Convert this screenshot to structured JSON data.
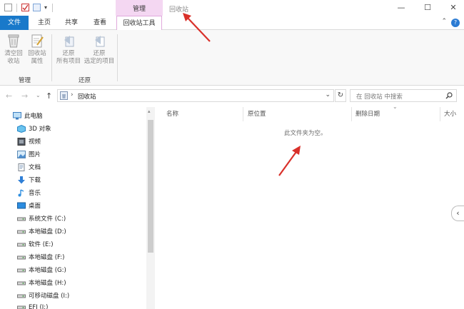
{
  "window": {
    "title": "回收站",
    "context_tab_group": "管理",
    "controls": {
      "minimize": "—",
      "maximize": "☐",
      "close": "✕"
    }
  },
  "tabs": [
    {
      "label": "文件"
    },
    {
      "label": "主页"
    },
    {
      "label": "共享"
    },
    {
      "label": "查看"
    },
    {
      "label": "回收站工具"
    }
  ],
  "ribbon": {
    "groups": [
      {
        "label": "管理",
        "buttons": [
          {
            "line1": "清空回",
            "line2": "收站",
            "icon": "empty-recycle-bin-icon"
          },
          {
            "line1": "回收站",
            "line2": "属性",
            "icon": "recycle-bin-properties-icon"
          }
        ]
      },
      {
        "label": "还原",
        "buttons": [
          {
            "line1": "还原",
            "line2": "所有项目",
            "icon": "restore-all-icon"
          },
          {
            "line1": "还原",
            "line2": "选定的项目",
            "icon": "restore-selected-icon"
          }
        ]
      }
    ]
  },
  "address": {
    "path": "回收站",
    "search_placeholder": "在 回收站 中搜索"
  },
  "nav": {
    "items": [
      {
        "label": "此电脑",
        "icon": "pc-icon"
      },
      {
        "label": "3D 对象",
        "icon": "3d-objects-icon"
      },
      {
        "label": "视频",
        "icon": "videos-icon"
      },
      {
        "label": "图片",
        "icon": "pictures-icon"
      },
      {
        "label": "文档",
        "icon": "documents-icon"
      },
      {
        "label": "下载",
        "icon": "downloads-icon"
      },
      {
        "label": "音乐",
        "icon": "music-icon"
      },
      {
        "label": "桌面",
        "icon": "desktop-icon"
      },
      {
        "label": "系统文件 (C:)",
        "icon": "drive-icon"
      },
      {
        "label": "本地磁盘 (D:)",
        "icon": "drive-icon"
      },
      {
        "label": "软件 (E:)",
        "icon": "drive-icon"
      },
      {
        "label": "本地磁盘 (F:)",
        "icon": "drive-icon"
      },
      {
        "label": "本地磁盘 (G:)",
        "icon": "drive-icon"
      },
      {
        "label": "本地磁盘 (H:)",
        "icon": "drive-icon"
      },
      {
        "label": "可移动磁盘 (I:)",
        "icon": "drive-icon"
      },
      {
        "label": "EFI (J:)",
        "icon": "drive-icon"
      }
    ]
  },
  "content": {
    "columns": [
      "名称",
      "原位置",
      "删除日期",
      "大小"
    ],
    "empty_message": "此文件夹为空。"
  },
  "colors": {
    "file_tab": "#1979ca",
    "context_tab": "#f4d7f2",
    "annotation_arrow": "#d9302a"
  }
}
